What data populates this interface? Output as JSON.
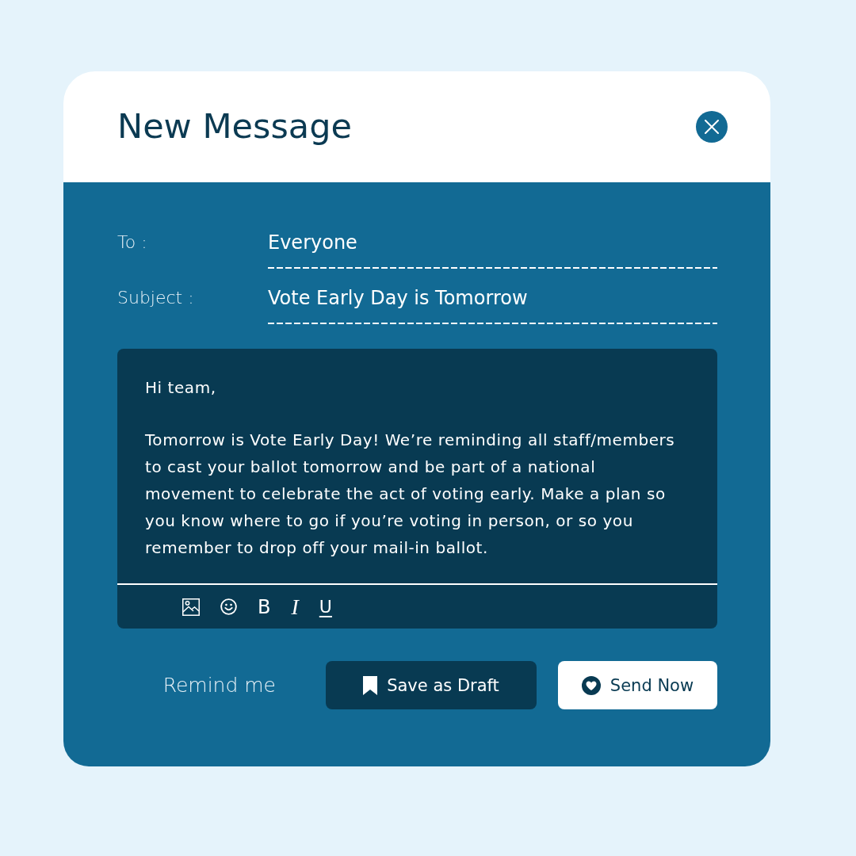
{
  "window": {
    "title": "New Message"
  },
  "fields": [
    {
      "label": "To :",
      "value": "Everyone"
    },
    {
      "label": "Subject :",
      "value": "Vote Early Day is Tomorrow"
    }
  ],
  "message": {
    "paragraphs": [
      "Hi team,",
      "Tomorrow is Vote Early Day! We’re reminding all staff/members to cast your ballot tomorrow and be part of a national movement to celebrate the act of voting early. Make a plan so you know where to go if you’re voting in person, or so you remember to drop off your mail-in ballot."
    ]
  },
  "format_buttons": [
    {
      "label": "B",
      "kind": "bold"
    },
    {
      "label": "I",
      "kind": "italic"
    },
    {
      "label": "U",
      "kind": "underline"
    }
  ],
  "actions": [
    {
      "label": "Remind me",
      "kind": "link"
    },
    {
      "label": "Save as Draft",
      "kind": "secondary"
    },
    {
      "label": "Send Now",
      "kind": "primary"
    }
  ]
}
